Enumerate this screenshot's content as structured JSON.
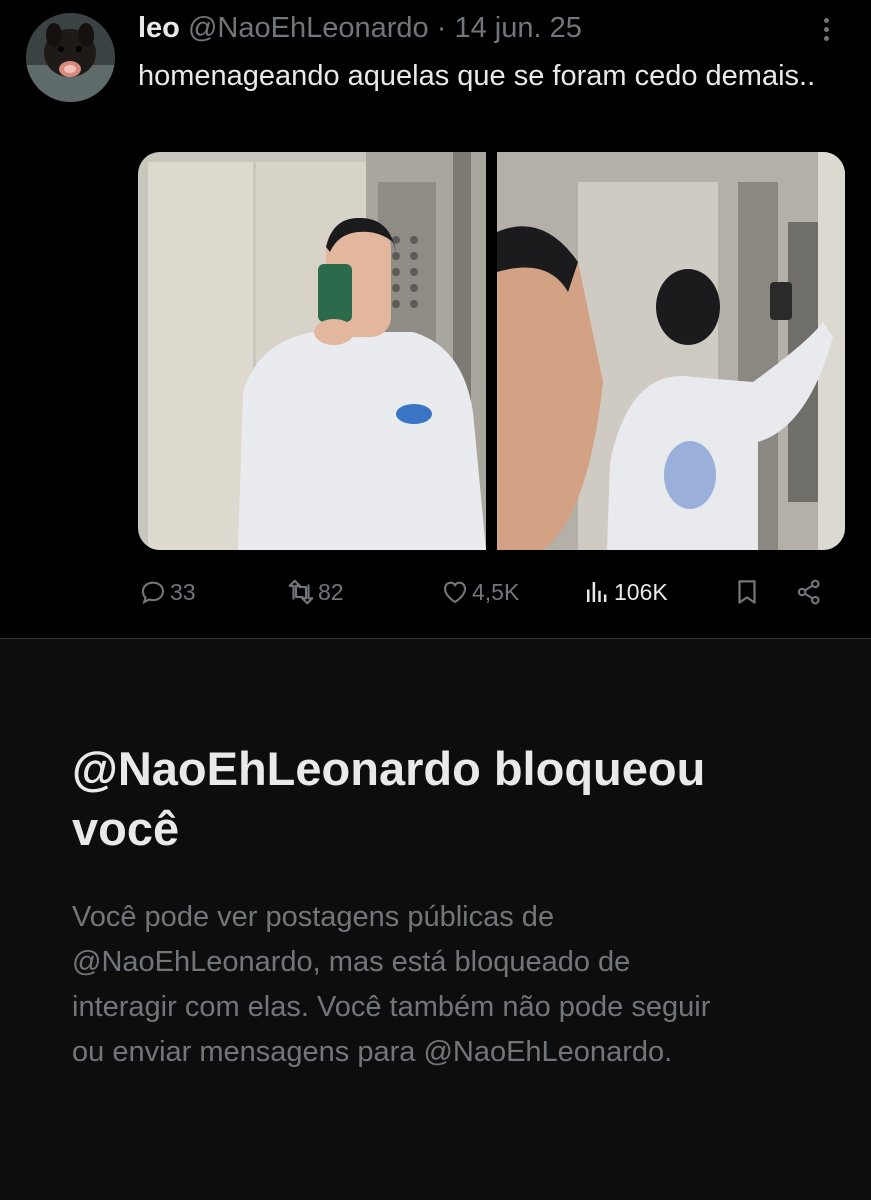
{
  "tweet": {
    "author_name": "leo",
    "author_handle": "@NaoEhLeonardo",
    "separator": "·",
    "date": "14 jun. 25",
    "text": "homenageando aquelas que se foram cedo demais..",
    "media": [
      {
        "description": "elevator mirror selfie, man in white hoodie holding green phone"
      },
      {
        "description": "elevator selfie, face close-up and back view of white hoodie"
      }
    ],
    "actions": {
      "replies": "33",
      "reposts": "82",
      "likes": "4,5K",
      "views": "106K"
    },
    "icons": [
      "reply-icon",
      "repost-icon",
      "like-icon",
      "views-icon",
      "bookmark-icon",
      "share-icon",
      "more-icon"
    ]
  },
  "block_notice": {
    "title": "@NaoEhLeonardo bloqueou você",
    "description": "Você pode ver postagens públicas de @NaoEhLeonardo, mas está bloqueado de interagir com elas. Você também não pode seguir ou enviar mensagens para @NaoEhLeonardo."
  },
  "colors": {
    "background": "#000000",
    "block_background": "#0d0d0d",
    "primary_text": "#e7e9ea",
    "secondary_text": "#71767b",
    "divider": "#2f3336"
  }
}
